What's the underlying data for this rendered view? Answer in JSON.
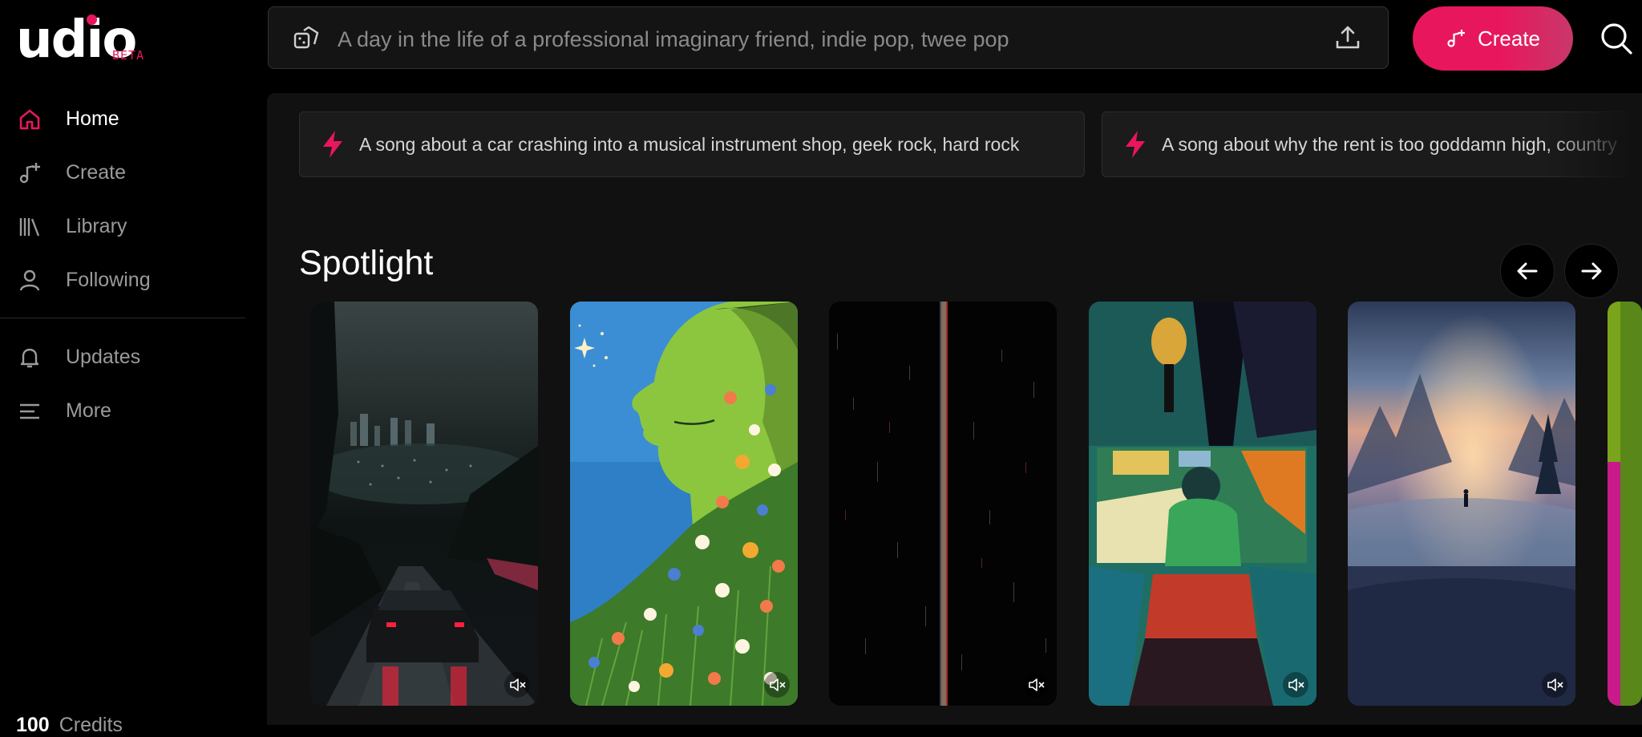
{
  "brand": {
    "name": "udio",
    "badge": "BETA",
    "accent": "#e8175d"
  },
  "sidebar": {
    "items": [
      {
        "label": "Home",
        "icon": "home-icon",
        "active": true
      },
      {
        "label": "Create",
        "icon": "music-plus-icon",
        "active": false
      },
      {
        "label": "Library",
        "icon": "library-icon",
        "active": false
      },
      {
        "label": "Following",
        "icon": "user-icon",
        "active": false
      }
    ],
    "secondary": [
      {
        "label": "Updates",
        "icon": "bell-icon"
      },
      {
        "label": "More",
        "icon": "menu-lines-icon"
      }
    ],
    "credits": {
      "value": "100",
      "label": "Credits"
    }
  },
  "topbar": {
    "prompt_placeholder": "A day in the life of a professional imaginary friend, indie pop, twee pop",
    "create_label": "Create"
  },
  "suggestions": [
    "A song about a car crashing into a musical instrument shop, geek rock, hard rock",
    "A song about why the rent is too goddamn high, country"
  ],
  "spotlight": {
    "title": "Spotlight",
    "cards": [
      {
        "name": "night-city-car-art"
      },
      {
        "name": "green-face-flowers-art"
      },
      {
        "name": "glitch-lines-art"
      },
      {
        "name": "painted-figure-art"
      },
      {
        "name": "misty-mountain-sunset-art"
      }
    ]
  }
}
